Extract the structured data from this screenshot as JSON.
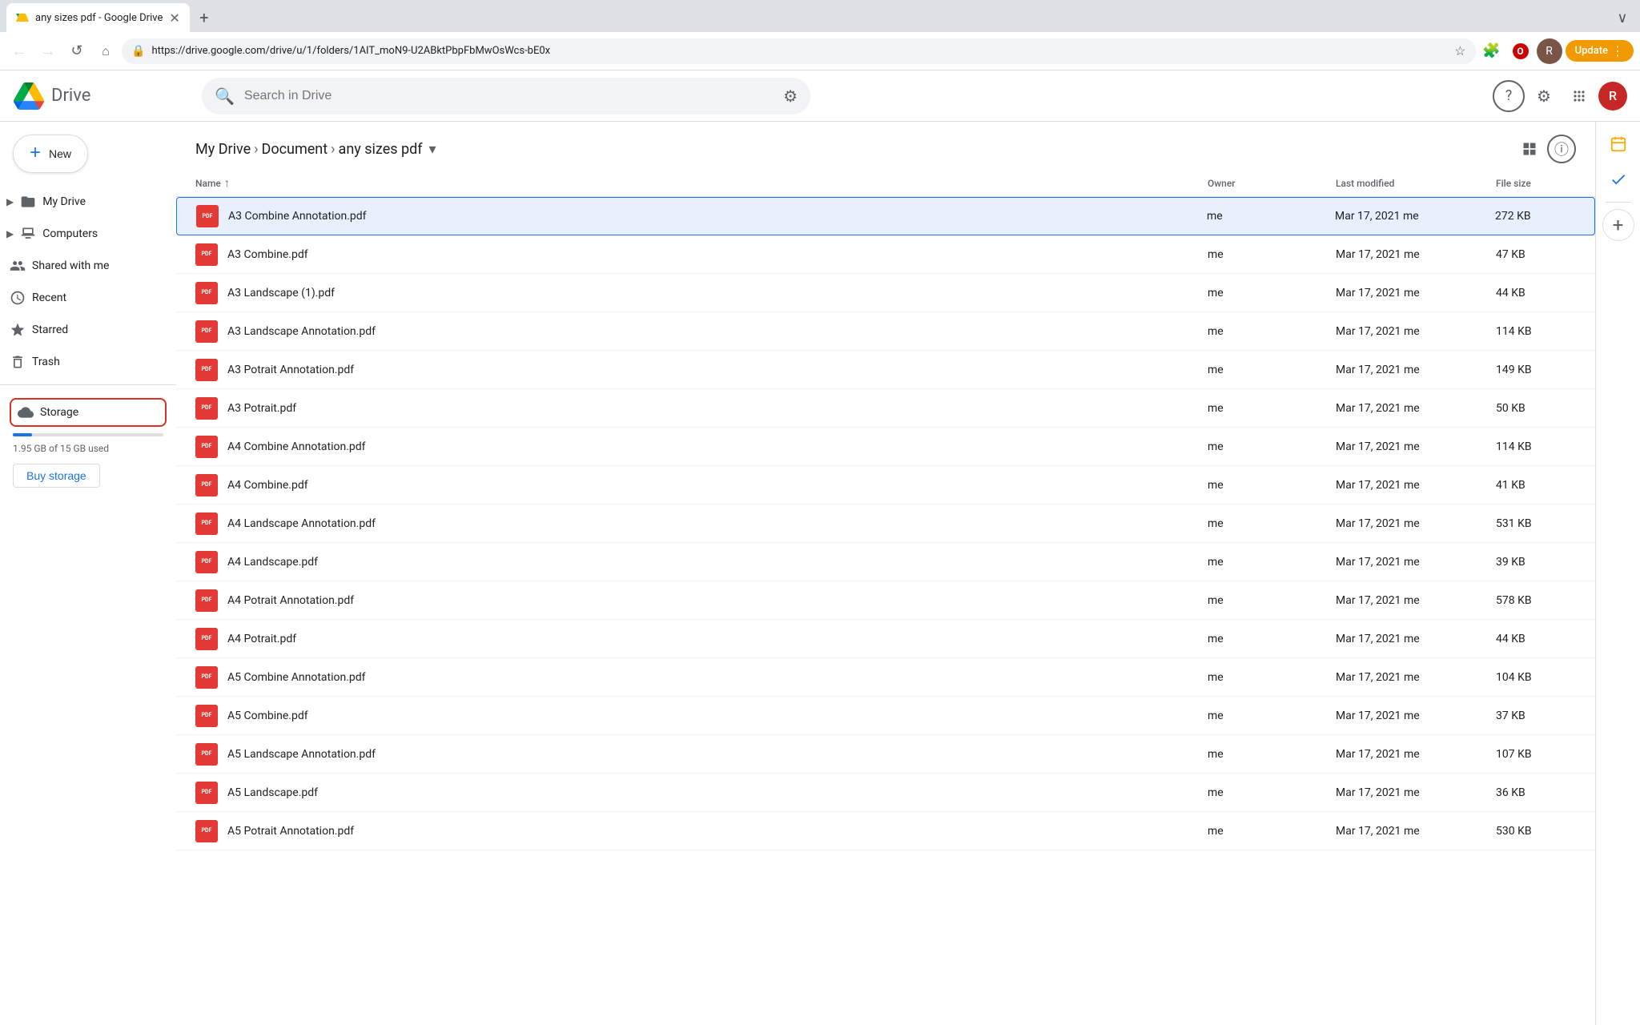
{
  "browser": {
    "tab": {
      "title": "any sizes pdf - Google Drive",
      "favicon": "G"
    },
    "new_tab_label": "+",
    "address": "https://drive.google.com/drive/u/1/folders/1AIT_moN9-U2ABktPbpFbMwOsWcs-bE0x",
    "nav": {
      "back": "←",
      "forward": "→",
      "reload": "↺",
      "home": "⌂"
    },
    "actions": {
      "star": "☆",
      "extensions": "⬡",
      "avatar": "R",
      "update": "Update",
      "menu": "⋮"
    }
  },
  "header": {
    "logo_text": "Drive",
    "search_placeholder": "Search in Drive",
    "help_icon": "?",
    "settings_icon": "⚙",
    "apps_icon": "⋮⋮⋮",
    "avatar": "R"
  },
  "sidebar": {
    "new_button": "New",
    "items": [
      {
        "id": "my-drive",
        "label": "My Drive",
        "icon": "folder",
        "expandable": true
      },
      {
        "id": "computers",
        "label": "Computers",
        "icon": "monitor",
        "expandable": true
      },
      {
        "id": "shared-with-me",
        "label": "Shared with me",
        "icon": "people"
      },
      {
        "id": "recent",
        "label": "Recent",
        "icon": "clock"
      },
      {
        "id": "starred",
        "label": "Starred",
        "icon": "star"
      },
      {
        "id": "trash",
        "label": "Trash",
        "icon": "trash"
      }
    ],
    "storage": {
      "label": "Storage",
      "icon": "cloud",
      "used": "1.95 GB of 15 GB used",
      "percent": 13,
      "buy_label": "Buy storage"
    }
  },
  "breadcrumb": {
    "items": [
      {
        "label": "My Drive"
      },
      {
        "label": "Document"
      },
      {
        "label": "any sizes pdf"
      }
    ]
  },
  "file_list": {
    "columns": {
      "name": "Name",
      "owner": "Owner",
      "modified": "Last modified",
      "size": "File size"
    },
    "files": [
      {
        "name": "A3 Combine Annotation.pdf",
        "owner": "me",
        "modified": "Mar 17, 2021  me",
        "size": "272 KB",
        "selected": true
      },
      {
        "name": "A3 Combine.pdf",
        "owner": "me",
        "modified": "Mar 17, 2021  me",
        "size": "47 KB",
        "selected": false
      },
      {
        "name": "A3 Landscape (1).pdf",
        "owner": "me",
        "modified": "Mar 17, 2021  me",
        "size": "44 KB",
        "selected": false
      },
      {
        "name": "A3 Landscape Annotation.pdf",
        "owner": "me",
        "modified": "Mar 17, 2021  me",
        "size": "114 KB",
        "selected": false
      },
      {
        "name": "A3 Potrait Annotation.pdf",
        "owner": "me",
        "modified": "Mar 17, 2021  me",
        "size": "149 KB",
        "selected": false
      },
      {
        "name": "A3 Potrait.pdf",
        "owner": "me",
        "modified": "Mar 17, 2021  me",
        "size": "50 KB",
        "selected": false
      },
      {
        "name": "A4 Combine Annotation.pdf",
        "owner": "me",
        "modified": "Mar 17, 2021  me",
        "size": "114 KB",
        "selected": false
      },
      {
        "name": "A4 Combine.pdf",
        "owner": "me",
        "modified": "Mar 17, 2021  me",
        "size": "41 KB",
        "selected": false
      },
      {
        "name": "A4 Landscape Annotation.pdf",
        "owner": "me",
        "modified": "Mar 17, 2021  me",
        "size": "531 KB",
        "selected": false
      },
      {
        "name": "A4 Landscape.pdf",
        "owner": "me",
        "modified": "Mar 17, 2021  me",
        "size": "39 KB",
        "selected": false
      },
      {
        "name": "A4 Potrait Annotation.pdf",
        "owner": "me",
        "modified": "Mar 17, 2021  me",
        "size": "578 KB",
        "selected": false
      },
      {
        "name": "A4 Potrait.pdf",
        "owner": "me",
        "modified": "Mar 17, 2021  me",
        "size": "44 KB",
        "selected": false
      },
      {
        "name": "A5 Combine Annotation.pdf",
        "owner": "me",
        "modified": "Mar 17, 2021  me",
        "size": "104 KB",
        "selected": false
      },
      {
        "name": "A5 Combine.pdf",
        "owner": "me",
        "modified": "Mar 17, 2021  me",
        "size": "37 KB",
        "selected": false
      },
      {
        "name": "A5 Landscape Annotation.pdf",
        "owner": "me",
        "modified": "Mar 17, 2021  me",
        "size": "107 KB",
        "selected": false
      },
      {
        "name": "A5 Landscape.pdf",
        "owner": "me",
        "modified": "Mar 17, 2021  me",
        "size": "36 KB",
        "selected": false
      },
      {
        "name": "A5 Potrait Annotation.pdf",
        "owner": "me",
        "modified": "Mar 17, 2021  me",
        "size": "530 KB",
        "selected": false
      }
    ]
  },
  "right_panel": {
    "icons": [
      {
        "id": "calendar",
        "symbol": "📅"
      },
      {
        "id": "tasks",
        "symbol": "✓"
      },
      {
        "id": "add",
        "symbol": "+"
      }
    ]
  }
}
